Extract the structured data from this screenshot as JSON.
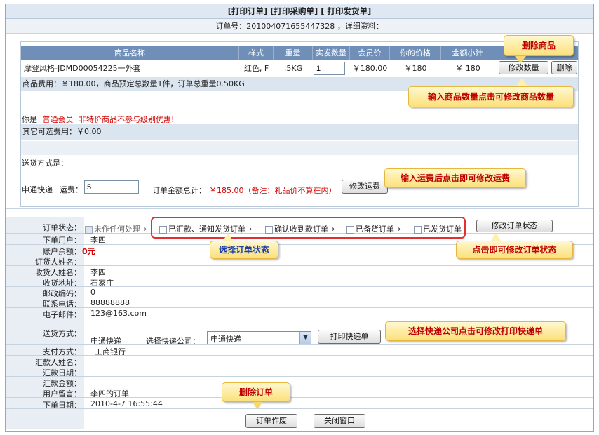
{
  "header": {
    "links": "[打印订单] [打印采购单] [ 打印发货单]",
    "order_line": "订单号：201004071655447328 ，详细资料："
  },
  "product_table": {
    "columns": [
      "商品名称",
      "样式",
      "重量",
      "实发数量",
      "会员价",
      "你的价格",
      "金额小计",
      ""
    ],
    "row": {
      "name": "摩登风格-JDMD00054225一外套",
      "style": "红色, F",
      "weight": ".5KG",
      "qty": "1",
      "member_price": "￥180.00",
      "your_price": "￥180",
      "subtotal": "￥ 180"
    },
    "modify_qty_label": "修改数量",
    "delete_label": "删除"
  },
  "summary": {
    "cost_line": "商品费用：￥180.00，商品预定总数量1件，订单总重量0.50KG"
  },
  "member": {
    "prefix": "你是",
    "level": "普通会员",
    "notice": "非特价商品不参与级别优惠!"
  },
  "other_fee": "其它可选费用：￥0.00",
  "shipping": {
    "label": "送货方式是：",
    "method": "申通快递",
    "fee_label": "运费：",
    "fee_value": "5",
    "total_label": "订单金额总计：",
    "total_value": "￥185.00（备注：礼品价不算在内）",
    "modify_fee_label": "修改运费"
  },
  "status": {
    "label": "订单状态：",
    "options": [
      "未作任何处理→",
      "已汇款、通知发货订单→",
      "确认收到款订单→",
      "已备货订单→",
      "已发货订单"
    ],
    "checked": [
      true,
      false,
      false,
      false,
      false
    ],
    "button": "修改订单状态"
  },
  "details": [
    {
      "label": "下单用户：",
      "value": "李四"
    },
    {
      "label": "账户余额：",
      "value": "0元"
    },
    {
      "label": "订货人姓名：",
      "value": ""
    },
    {
      "label": "收货人姓名：",
      "value": "李四"
    },
    {
      "label": "收货地址：",
      "value": "石家庄"
    },
    {
      "label": "邮政编码：",
      "value": "0"
    },
    {
      "label": "联系电话：",
      "value": "88888888"
    },
    {
      "label": "电子邮件：",
      "value": "123@163.com"
    }
  ],
  "delivery": {
    "label": "送货方式：",
    "method": "申通快递",
    "choose_label": "选择快递公司：",
    "selected": "申通快递",
    "print_button": "打印快递单"
  },
  "payment": [
    {
      "label": "支付方式：",
      "value": "工商银行"
    },
    {
      "label": "汇款人姓名：",
      "value": ""
    },
    {
      "label": "汇款日期：",
      "value": ""
    },
    {
      "label": "汇款金额：",
      "value": ""
    },
    {
      "label": "用户留言：",
      "value": "李四的订单"
    },
    {
      "label": "下单日期：",
      "value": "2010-4-7 16:55:44"
    }
  ],
  "footer": {
    "void_button": "订单作废",
    "close_button": "关闭窗口"
  },
  "callouts": {
    "delete_product": "删除商品",
    "modify_qty": "输入商品数量点击可修改商品数量",
    "modify_fee": "输入运费后点击即可修改运费",
    "choose_status": "选择订单状态",
    "modify_status": "点击即可修改订单状态",
    "choose_express": "选择快递公司点击可修改打印快递单",
    "delete_order": "删除订单"
  },
  "colors": {
    "table_header": "#6f8fb8",
    "band": "#dbe5f0",
    "callout_text": "#c00000",
    "red_text": "#d40000",
    "blue_callout_text": "#1a3fa7"
  }
}
